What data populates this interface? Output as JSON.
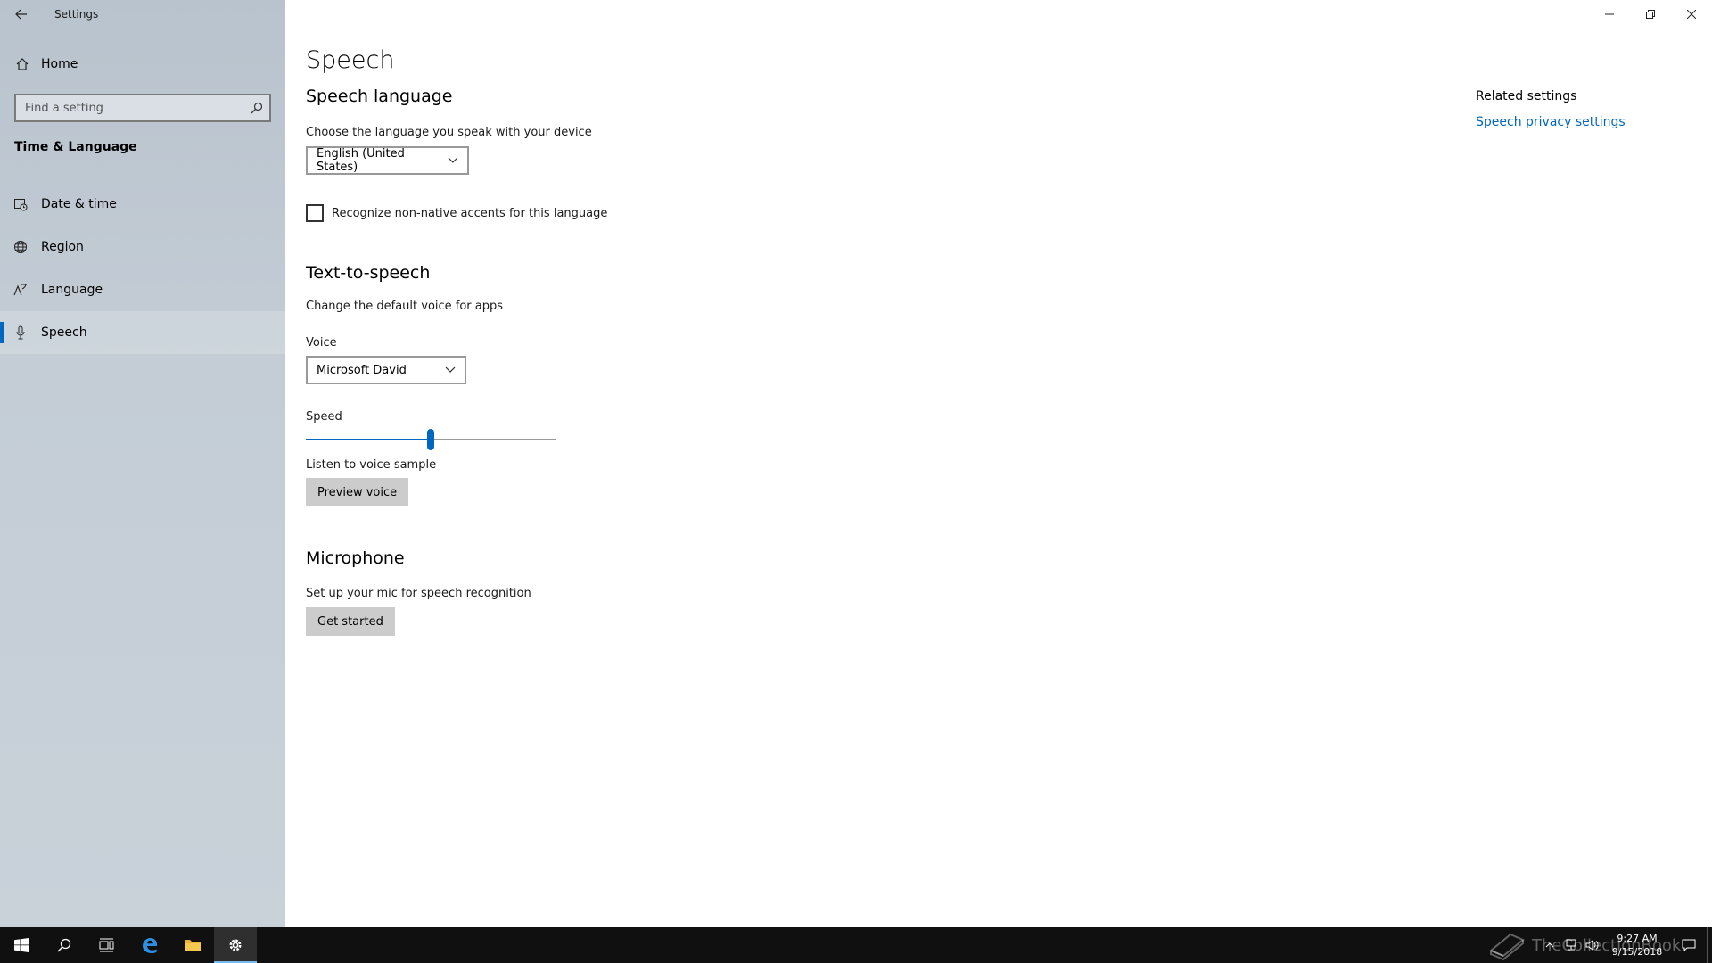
{
  "window": {
    "title": "Settings"
  },
  "sidebar": {
    "home_label": "Home",
    "search_placeholder": "Find a setting",
    "section_title": "Time & Language",
    "items": [
      {
        "label": "Date & time",
        "icon": "calendar-clock-icon"
      },
      {
        "label": "Region",
        "icon": "globe-icon"
      },
      {
        "label": "Language",
        "icon": "language-icon"
      },
      {
        "label": "Speech",
        "icon": "microphone-icon",
        "selected": true
      }
    ]
  },
  "main": {
    "page_title": "Speech",
    "speech_language": {
      "heading": "Speech language",
      "description": "Choose the language you speak with your device",
      "selected_language": "English (United States)",
      "checkbox_label": "Recognize non-native accents for this language",
      "checkbox_checked": false
    },
    "tts": {
      "heading": "Text-to-speech",
      "description": "Change the default voice for apps",
      "voice_label": "Voice",
      "voice_value": "Microsoft David",
      "speed_label": "Speed",
      "speed_fraction": 0.5,
      "sample_label": "Listen to voice sample",
      "preview_button": "Preview voice"
    },
    "microphone": {
      "heading": "Microphone",
      "description": "Set up your mic for speech recognition",
      "button": "Get started"
    }
  },
  "related": {
    "title": "Related settings",
    "link": "Speech privacy settings"
  },
  "taskbar": {
    "time": "9:27 AM",
    "date": "9/15/2018",
    "watermark": "TheCollectionBook"
  },
  "colors": {
    "accent": "#0067c0",
    "taskbar": "#101010"
  }
}
